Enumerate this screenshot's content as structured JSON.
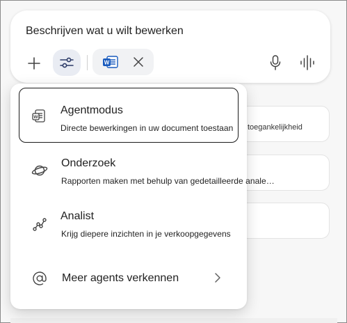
{
  "compose": {
    "prompt_text": "Beschrijven wat u wilt bewerken"
  },
  "background_cards": [
    {
      "text": "toegankelijkheid"
    },
    {
      "text": ""
    },
    {
      "text": ""
    }
  ],
  "menu": {
    "items": [
      {
        "title": "Agentmodus",
        "description": "Directe bewerkingen in uw document toestaan",
        "icon": "agent-document-icon",
        "selected": true
      },
      {
        "title": "Onderzoek",
        "description": "Rapporten maken met behulp van gedetailleerde anale…",
        "icon": "planet-icon",
        "selected": false
      },
      {
        "title": "Analist",
        "description": "Krijg diepere inzichten in je verkoopgegevens",
        "icon": "line-chart-icon",
        "selected": false
      },
      {
        "title": "Meer agents verkennen",
        "icon": "at-sign-icon",
        "selected": false
      }
    ]
  },
  "icons": {
    "word_color": "#185abd",
    "settings_active_bg": "#e9ecf3"
  }
}
